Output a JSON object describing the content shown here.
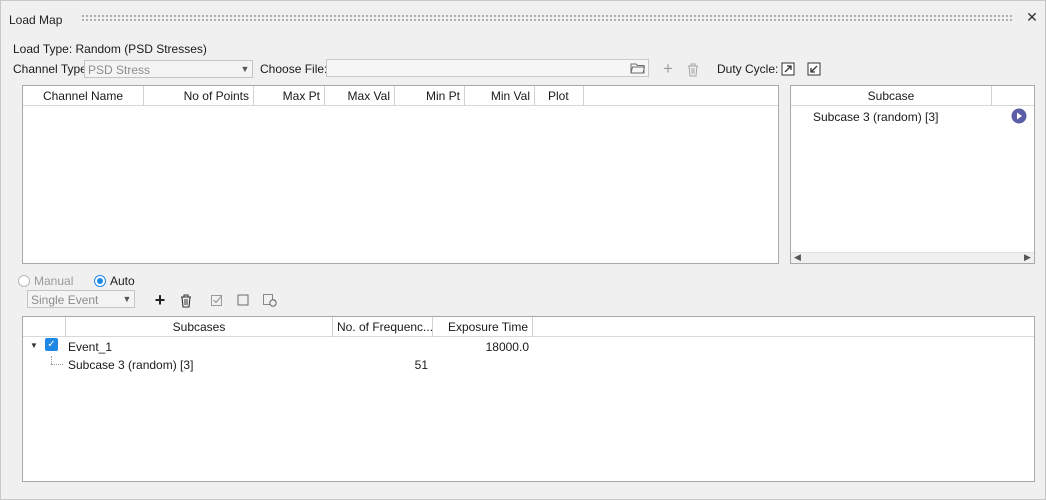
{
  "window": {
    "title": "Load Map"
  },
  "load_type": {
    "label": "Load Type: Random (PSD Stresses)"
  },
  "channel_type": {
    "label": "Channel Type:",
    "value": "PSD Stress"
  },
  "choose_file": {
    "label": "Choose File:",
    "value": ""
  },
  "duty_cycle": {
    "label": "Duty Cycle:"
  },
  "channel_table": {
    "columns": [
      "Channel Name",
      "No of Points",
      "Max Pt",
      "Max Val",
      "Min Pt",
      "Min Val",
      "Plot"
    ]
  },
  "subcase_panel": {
    "header": "Subcase",
    "items": [
      {
        "label": "Subcase 3 (random) [3]"
      }
    ]
  },
  "mode": {
    "manual_label": "Manual",
    "auto_label": "Auto",
    "selected": "Auto"
  },
  "event_type": {
    "value": "Single Event"
  },
  "events_table": {
    "columns": [
      "Subcases",
      "No. of Frequenc...",
      "Exposure Time"
    ],
    "rows": [
      {
        "name": "Event_1",
        "frequencies": "",
        "exposure": "18000.0",
        "checked": true,
        "expanded": true
      },
      {
        "name": "Subcase 3 (random) [3]",
        "frequencies": "51",
        "exposure": ""
      }
    ]
  },
  "icons": {
    "close": "close-icon",
    "folder": "folder-icon",
    "add": "plus-icon",
    "delete": "trash-icon",
    "duty_cycle_export": "export-icon",
    "duty_cycle_check": "checkbox-check-icon",
    "play": "play-icon",
    "check_all": "check-all-icon",
    "uncheck_all": "uncheck-icon",
    "refresh": "refresh-icon"
  },
  "colors": {
    "accent": "#1e88e5",
    "play": "#5b5ea6"
  }
}
